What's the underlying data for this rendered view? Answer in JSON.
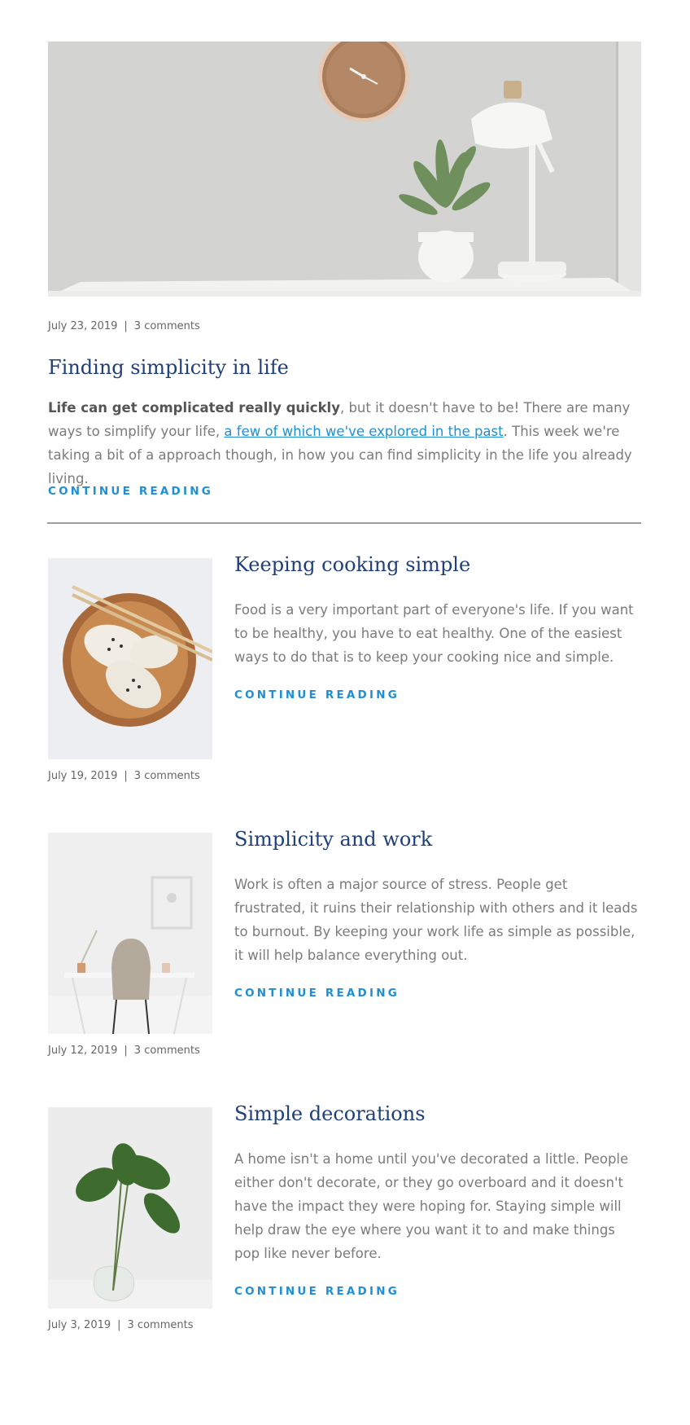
{
  "featured": {
    "date": "July 23, 2019",
    "separator": "|",
    "comments": "3 comments",
    "title": "Finding simplicity in life",
    "excerpt_bold": "Life can get complicated really quickly",
    "excerpt_part1": ", but it doesn't have to be! There are many ways to simplify your life, ",
    "excerpt_link": "a few of which we've explored in the past",
    "excerpt_part2": ". This week we're taking a bit of a approach though, in how you can find simplicity in the life you already living.",
    "continue_label": "CONTINUE READING"
  },
  "posts": [
    {
      "title": "Keeping cooking simple",
      "excerpt": "Food is a very important part of everyone's life. If you want to be healthy, you have to eat healthy. One of the easiest ways to do that is to keep your cooking nice and simple.",
      "continue_label": "CONTINUE READING",
      "date": "July 19, 2019",
      "separator": "|",
      "comments": "3 comments"
    },
    {
      "title": "Simplicity and work",
      "excerpt": "Work is often a major source of stress. People get frustrated, it ruins their relationship with others and it leads to burnout. By keeping your work life as simple as possible, it will help balance everything out.",
      "continue_label": "CONTINUE READING",
      "date": "July 12, 2019",
      "separator": "|",
      "comments": "3 comments"
    },
    {
      "title": "Simple decorations",
      "excerpt": "A home isn't a home until you've decorated a little. People either don't decorate, or they go overboard and it doesn't have the impact they were hoping for. Staying simple will help draw the eye where you want it to and make things pop like never before.",
      "continue_label": "CONTINUE READING",
      "date": "July 3, 2019",
      "separator": "|",
      "comments": "3 comments"
    }
  ],
  "colors": {
    "title": "#1f3f7a",
    "link": "#1e8fd6",
    "body_text": "#7b7b7b",
    "divider": "#9e9e9e"
  },
  "images": {
    "featured": "desk-with-clock-plant-lamp-photo",
    "post_0": "dumplings-on-wooden-plate-photo",
    "post_1": "minimal-desk-and-chair-photo",
    "post_2": "green-leaves-in-glass-vase-photo"
  }
}
